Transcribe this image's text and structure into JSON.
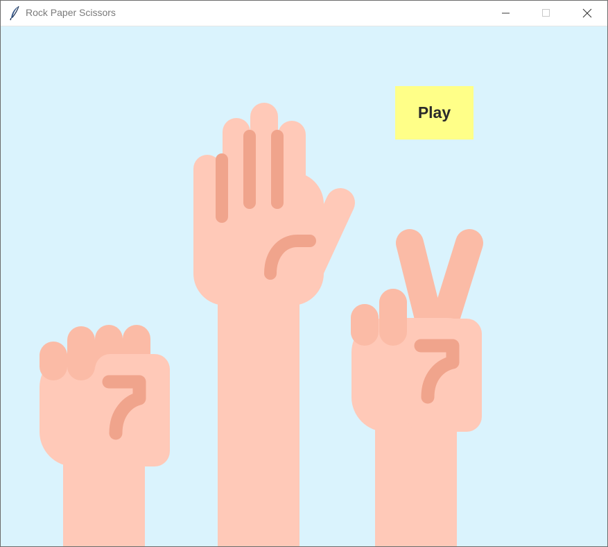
{
  "window": {
    "title": "Rock Paper Scissors",
    "app_icon": "feather-icon",
    "controls": [
      "minimize-icon",
      "maximize-icon",
      "close-icon"
    ]
  },
  "canvas": {
    "background": "#daf3fd"
  },
  "play_button": {
    "label": "Play",
    "color": "#ffff88"
  },
  "hands": [
    {
      "name": "rock-hand-icon"
    },
    {
      "name": "paper-hand-icon"
    },
    {
      "name": "scissors-hand-icon"
    }
  ],
  "colors": {
    "skin": "#ffc9b8",
    "skin_finger": "#fbbba6",
    "skin_crease": "#f0a48c"
  }
}
